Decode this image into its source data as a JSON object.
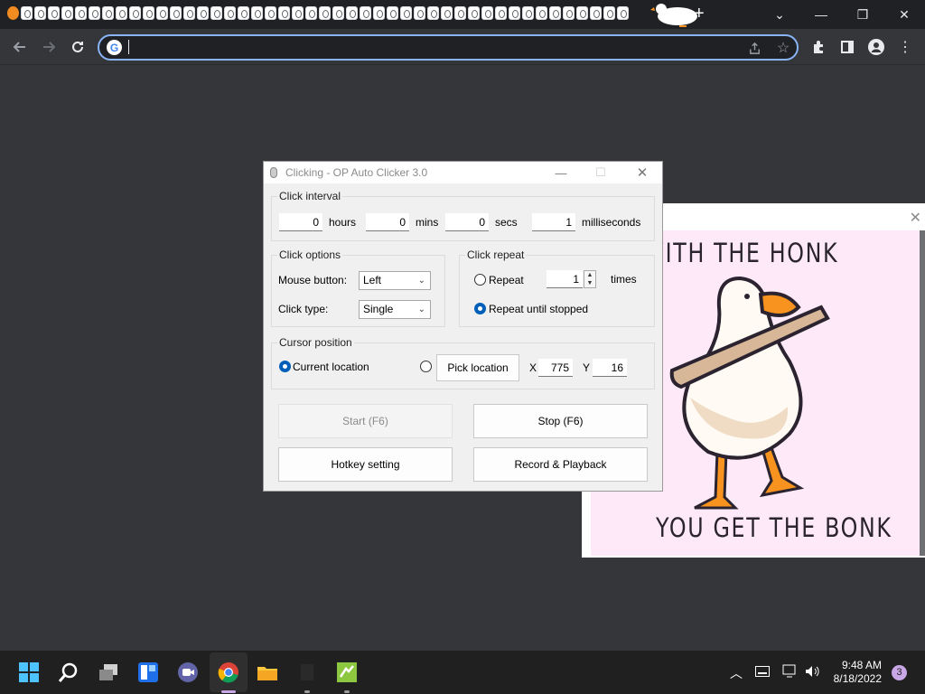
{
  "clicker": {
    "title": "Clicking - OP Auto Clicker 3.0",
    "interval": {
      "group_title": "Click interval",
      "hours": "0",
      "hours_label": "hours",
      "mins": "0",
      "mins_label": "mins",
      "secs": "0",
      "secs_label": "secs",
      "ms": "1",
      "ms_label": "milliseconds"
    },
    "options": {
      "group_title": "Click options",
      "mouse_button_label": "Mouse button:",
      "mouse_button_value": "Left",
      "click_type_label": "Click type:",
      "click_type_value": "Single"
    },
    "repeat": {
      "group_title": "Click repeat",
      "repeat_label": "Repeat",
      "repeat_count": "1",
      "times_label": "times",
      "until_stopped_label": "Repeat until stopped",
      "selected": "until_stopped"
    },
    "cursor": {
      "group_title": "Cursor position",
      "current_label": "Current location",
      "pick_label": "Pick location",
      "x_label": "X",
      "x_value": "775",
      "y_label": "Y",
      "y_value": "16",
      "selected": "current"
    },
    "buttons": {
      "start": "Start (F6)",
      "stop": "Stop (F6)",
      "hotkey": "Hotkey setting",
      "record": "Record & Playback"
    }
  },
  "meme": {
    "top_text": "MESS WITH THE HONK",
    "bottom_text": "YOU GET THE BONK"
  },
  "taskbar": {
    "time": "9:48 AM",
    "date": "8/18/2022",
    "notifications": "3"
  },
  "colors": {
    "accent": "#005fb8",
    "omnibox_focus": "#8ab4f8",
    "meme_bg": "#fde9f8",
    "goose_beak": "#f7931e"
  }
}
